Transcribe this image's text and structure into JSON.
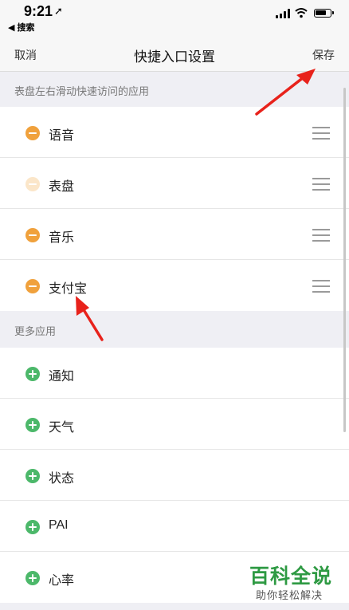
{
  "status_bar": {
    "time": "9:21",
    "location_icon": "location-arrow-icon",
    "back_app": "◀ 搜索"
  },
  "nav": {
    "cancel": "取消",
    "title": "快捷入口设置",
    "save": "保存"
  },
  "sections": {
    "shortcuts_header": "表盘左右滑动快速访问的应用",
    "more_header": "更多应用"
  },
  "shortcut_apps": [
    {
      "label": "语音",
      "icon": "remove-circle-icon"
    },
    {
      "label": "表盘",
      "icon": "remove-circle-icon",
      "disabled": true
    },
    {
      "label": "音乐",
      "icon": "remove-circle-icon"
    },
    {
      "label": "支付宝",
      "icon": "remove-circle-icon"
    }
  ],
  "more_apps": [
    {
      "label": "通知",
      "icon": "add-circle-icon"
    },
    {
      "label": "天气",
      "icon": "add-circle-icon"
    },
    {
      "label": "状态",
      "icon": "add-circle-icon"
    },
    {
      "label": "PAI",
      "icon": "add-circle-icon"
    },
    {
      "label": "心率",
      "icon": "add-circle-icon"
    }
  ],
  "watermark": {
    "title": "百科全说",
    "subtitle": "助你轻松解决"
  },
  "colors": {
    "remove": "#f0a13c",
    "add": "#4cb86a",
    "annotation_arrow": "#e8221b",
    "watermark": "#2e9a43"
  }
}
